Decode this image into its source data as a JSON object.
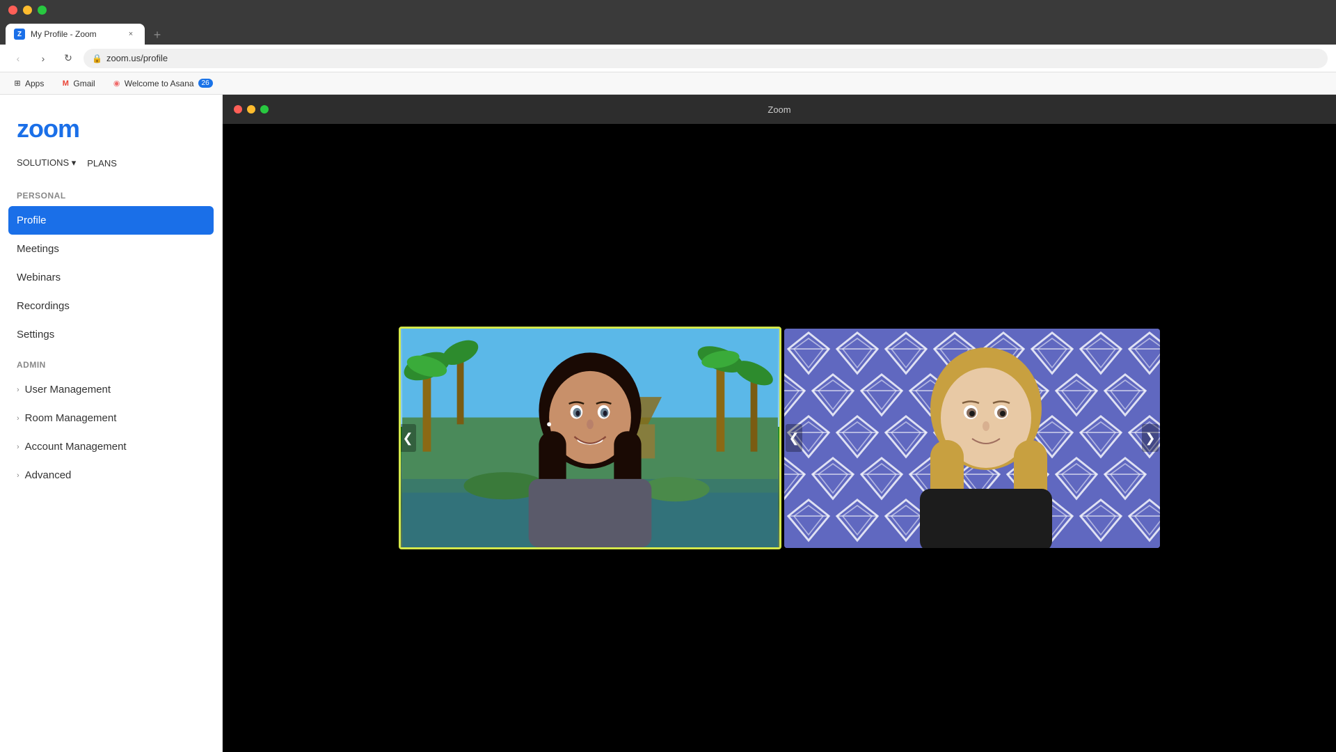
{
  "browser": {
    "tab_title": "My Profile - Zoom",
    "tab_favicon_text": "Z",
    "new_tab_label": "+",
    "close_tab_label": "×",
    "address": "zoom.us/profile",
    "nav": {
      "back_label": "‹",
      "forward_label": "›",
      "refresh_label": "↻"
    },
    "bookmarks": [
      {
        "id": "apps",
        "icon": "⊞",
        "label": "Apps"
      },
      {
        "id": "gmail",
        "icon": "M",
        "label": "Gmail"
      },
      {
        "id": "asana",
        "icon": "◉",
        "label": "Welcome to Asana",
        "badge": "26"
      }
    ]
  },
  "website": {
    "logo": "zoom",
    "nav_items": [
      "SOLUTIONS ▾",
      "PLANS"
    ],
    "sidebar": {
      "personal_label": "PERSONAL",
      "items": [
        {
          "id": "profile",
          "label": "Profile",
          "active": true
        },
        {
          "id": "meetings",
          "label": "Meetings",
          "active": false
        },
        {
          "id": "webinars",
          "label": "Webinars",
          "active": false
        },
        {
          "id": "recordings",
          "label": "Recordings",
          "active": false
        },
        {
          "id": "settings",
          "label": "Settings",
          "active": false
        }
      ],
      "admin_label": "ADMIN",
      "admin_items": [
        {
          "id": "user-management",
          "label": "User Management",
          "expandable": true
        },
        {
          "id": "room-management",
          "label": "Room Management",
          "expandable": true
        },
        {
          "id": "account-management",
          "label": "Account Management",
          "expandable": true
        },
        {
          "id": "advanced",
          "label": "Advanced",
          "expandable": true
        }
      ]
    }
  },
  "zoom_app": {
    "title": "Zoom",
    "nav_arrow_left": "❮",
    "nav_arrow_right": "❯"
  },
  "colors": {
    "zoom_blue": "#1a6fe8",
    "active_tab_bg": "#1a6fe8",
    "diamond_bg": "#6366c0",
    "video_border": "#d4e84a"
  }
}
